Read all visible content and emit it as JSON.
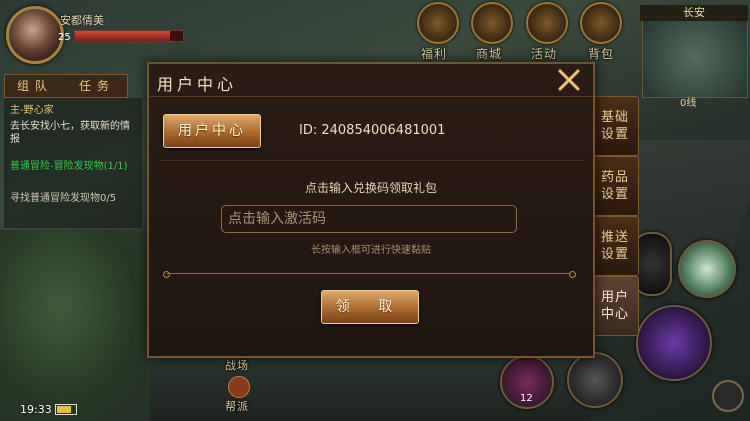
{
  "player": {
    "name": "安都倩美",
    "level": "25",
    "hp_fraction": 0.88
  },
  "top_menu": [
    {
      "label": "福利",
      "icon": "gift-icon"
    },
    {
      "label": "商城",
      "icon": "shop-icon"
    },
    {
      "label": "活动",
      "icon": "event-icon"
    },
    {
      "label": "背包",
      "icon": "bag-icon"
    }
  ],
  "minimap": {
    "area": "长安",
    "line": "0线"
  },
  "quest_panel": {
    "tabs": [
      "组队",
      "任务"
    ],
    "lines": [
      {
        "text": "主-野心家",
        "color": "#e2c270"
      },
      {
        "text": "去长安找小七，获取新的情报",
        "color": "#e6e0d0"
      },
      {
        "text": "普通冒险-冒险发现物(1/1)",
        "color": "#35c84a"
      },
      {
        "text": "寻找普通冒险发现物0/5",
        "color": "#cfc7b3"
      }
    ]
  },
  "bottom": {
    "time": "19:33",
    "battery_level": 0.75,
    "side_labels": [
      "战场",
      "帮派"
    ],
    "skill_count": "12"
  },
  "settings_tabs": [
    {
      "label": "基础\n设置",
      "active": false
    },
    {
      "label": "药品\n设置",
      "active": false
    },
    {
      "label": "推送\n设置",
      "active": false
    },
    {
      "label": "用户\n中心",
      "active": true
    }
  ],
  "dialog": {
    "title": "用户中心",
    "tab_label": "用户中心",
    "user_id": "ID: 240854006481001",
    "prompt": "点击输入兑换码领取礼包",
    "input_placeholder": "点击输入激活码",
    "hint": "长按输入框可进行快速黏贴",
    "claim_label": "领 取",
    "close_icon": "close-icon"
  },
  "colors": {
    "accent_gold": "#c8873f",
    "panel_bg": "#231912"
  }
}
